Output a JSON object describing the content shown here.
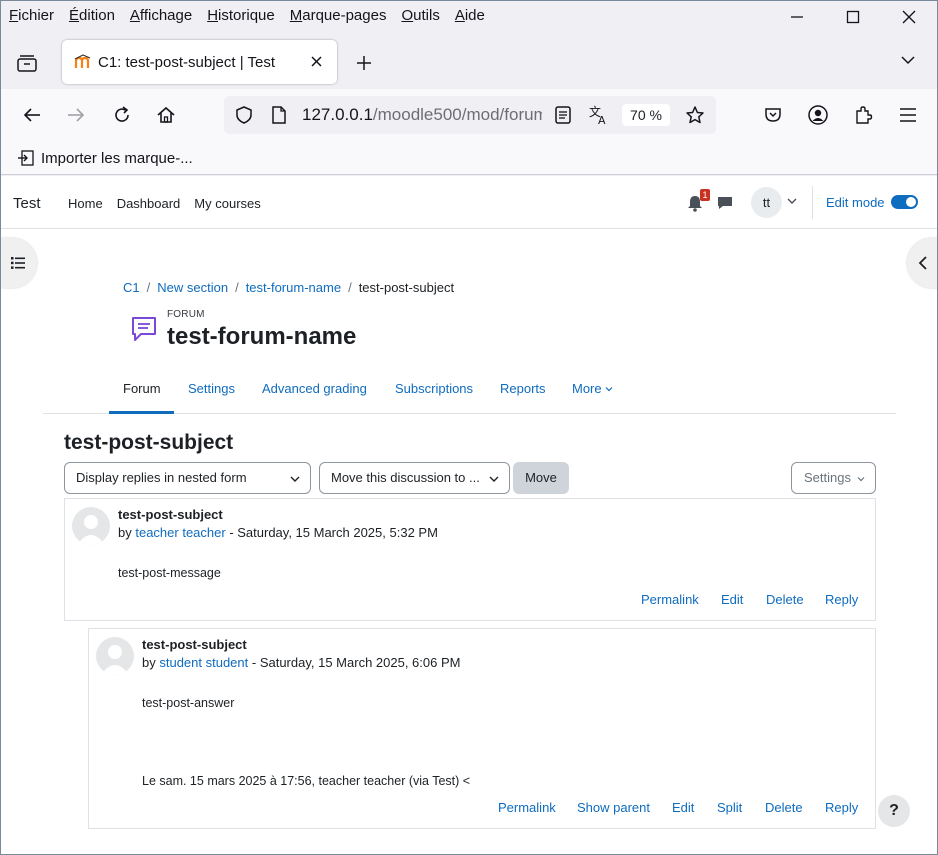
{
  "menubar": {
    "items": [
      {
        "first": "F",
        "rest": "ichier"
      },
      {
        "first": "É",
        "rest": "dition"
      },
      {
        "first": "A",
        "rest": "ffichage"
      },
      {
        "first": "H",
        "rest": "istorique"
      },
      {
        "first": "M",
        "rest": "arque-pages"
      },
      {
        "first": "O",
        "rest": "utils"
      },
      {
        "first": "A",
        "rest": "ide"
      }
    ]
  },
  "tab": {
    "title": "C1: test-post-subject | Test"
  },
  "navbar": {
    "url_host": "127.0.0.1",
    "url_path": "/moodle500/mod/forum",
    "zoom": "70 %"
  },
  "bookmarks": {
    "import_label": "Importer les marque-..."
  },
  "moodle": {
    "brand": "Test",
    "nav": [
      "Home",
      "Dashboard",
      "My courses"
    ],
    "notification_count": "1",
    "user_initials": "tt",
    "edit_mode_label": "Edit mode"
  },
  "breadcrumb": [
    "C1",
    "New section",
    "test-forum-name",
    "test-post-subject"
  ],
  "module": {
    "type": "FORUM",
    "title": "test-forum-name"
  },
  "secondary_nav": [
    "Forum",
    "Settings",
    "Advanced grading",
    "Subscriptions",
    "Reports",
    "More"
  ],
  "discussion": {
    "title": "test-post-subject",
    "display_select": "Display replies in nested form",
    "move_select": "Move this discussion to ...",
    "move_button": "Move",
    "settings_button": "Settings"
  },
  "posts": [
    {
      "subject": "test-post-subject",
      "by": "by",
      "author": "teacher teacher",
      "date": " - Saturday, 15 March 2025, 5:32 PM",
      "message": "test-post-message",
      "actions": [
        "Permalink",
        "Edit",
        "Delete",
        "Reply"
      ]
    },
    {
      "subject": "test-post-subject",
      "by": "by",
      "author": "student student",
      "date": " - Saturday, 15 March 2025, 6:06 PM",
      "message": "test-post-answer",
      "quote": "Le sam. 15 mars 2025 à 17:56, teacher teacher (via Test) <",
      "actions": [
        "Permalink",
        "Show parent",
        "Edit",
        "Split",
        "Delete",
        "Reply"
      ]
    }
  ],
  "help": {
    "label": "?"
  }
}
